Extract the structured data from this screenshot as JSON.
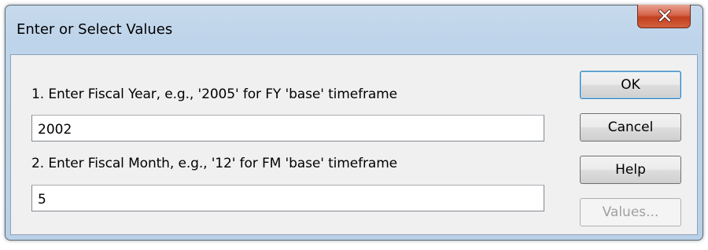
{
  "window": {
    "title": "Enter or Select Values"
  },
  "form": {
    "fiscal_year_label": "1. Enter Fiscal Year, e.g., '2005' for FY 'base' timeframe",
    "fiscal_year_value": "2002",
    "fiscal_month_label": "2. Enter Fiscal Month, e.g., '12' for FM 'base' timeframe",
    "fiscal_month_value": "5"
  },
  "buttons": {
    "ok": "OK",
    "cancel": "Cancel",
    "help": "Help",
    "values": "Values..."
  },
  "icons": {
    "close": "close-icon"
  }
}
